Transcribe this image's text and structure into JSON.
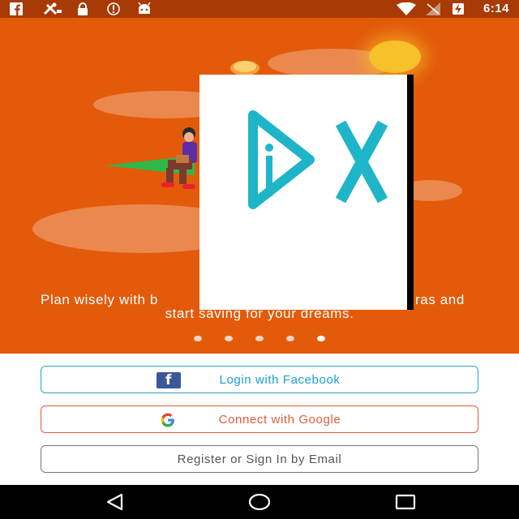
{
  "status_bar": {
    "time": "6:14",
    "icons": [
      "facebook-icon",
      "tools-icon",
      "lock-icon",
      "alert-icon",
      "android-icon",
      "wifi-icon",
      "no-signal-icon",
      "battery-charging-icon"
    ]
  },
  "hero": {
    "tagline_line1": "Plan wisely with b",
    "tagline_line1_end": "ras and",
    "tagline_line2": "start saving for your dreams.",
    "carousel": {
      "count": 5,
      "active_index": 4
    },
    "overlay_ad": "ad-logo-icon"
  },
  "buttons": {
    "facebook": {
      "label": "Login with Facebook",
      "icon": "facebook-icon"
    },
    "google": {
      "label": "Connect with Google",
      "icon": "google-icon"
    },
    "email": {
      "label": "Register or Sign In by Email"
    }
  },
  "nav_bar": {
    "icons": [
      "back-icon",
      "home-icon",
      "recents-icon"
    ]
  },
  "colors": {
    "hero_bg": "#e35a0b",
    "status_bar_bg": "#a83a05",
    "facebook_accent": "#1aa0cf",
    "google_accent": "#e55a3a",
    "email_text": "#555555"
  }
}
